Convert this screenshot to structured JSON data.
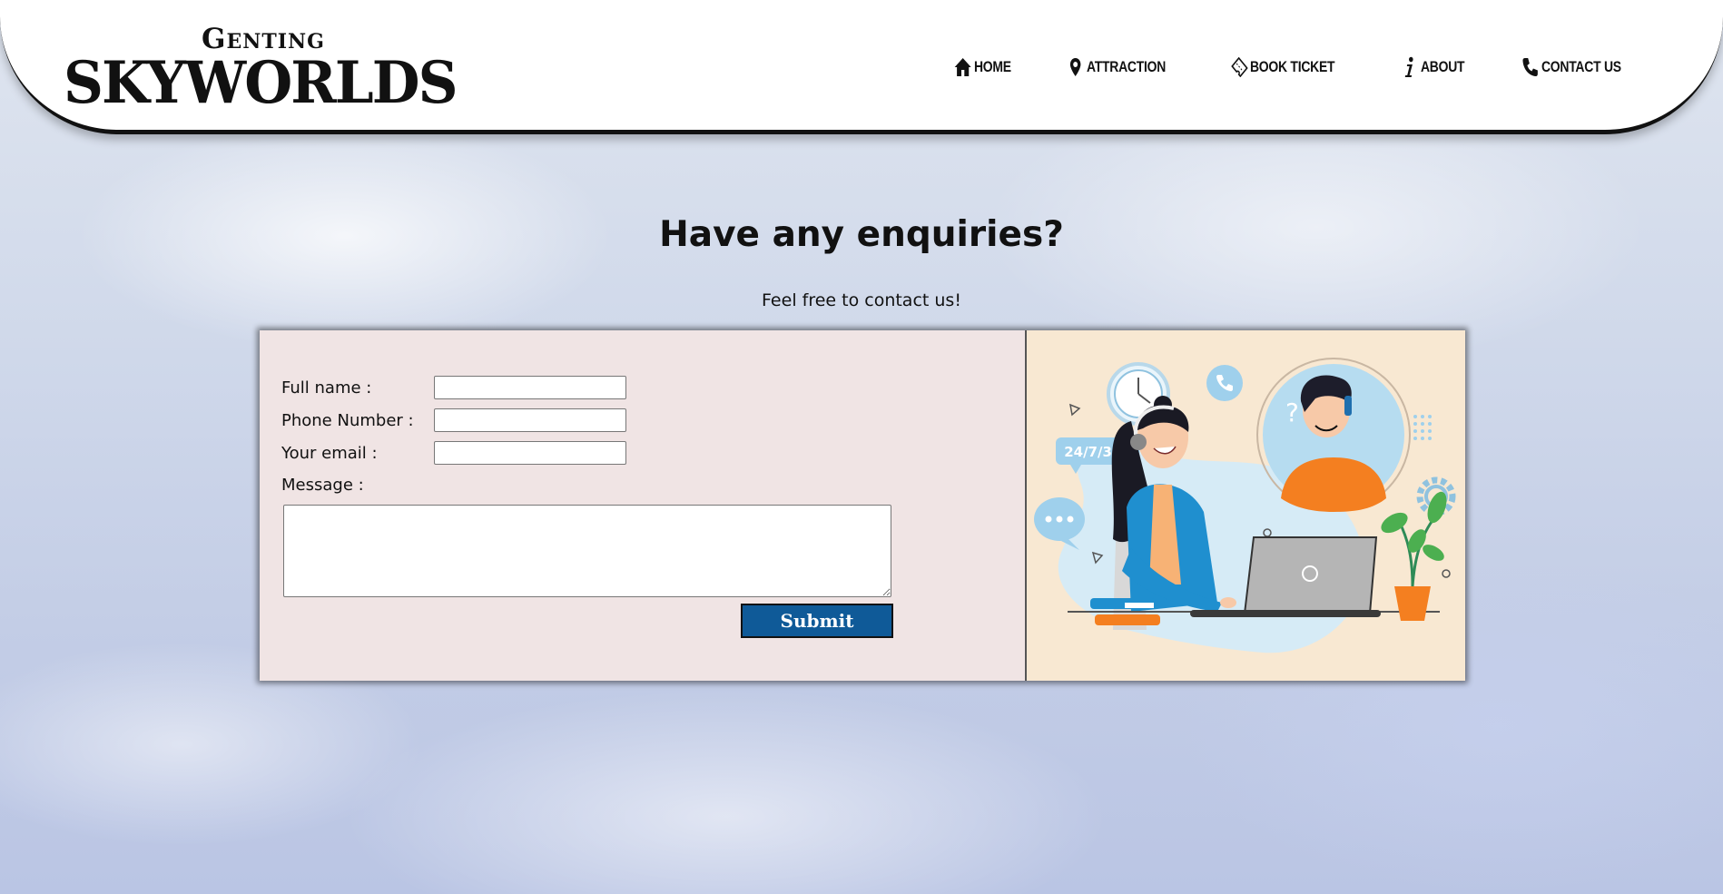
{
  "logo": {
    "top_text": "Genting",
    "main_text": "SKYWORLDS"
  },
  "nav": {
    "items": [
      {
        "label": "HOME",
        "icon": "home-icon"
      },
      {
        "label": "ATTRACTION",
        "icon": "map-pin-icon"
      },
      {
        "label": "BOOK TICKET",
        "icon": "ticket-icon"
      },
      {
        "label": "ABOUT",
        "icon": "info-icon"
      },
      {
        "label": "CONTACT US",
        "icon": "phone-icon"
      }
    ]
  },
  "main": {
    "title": "Have any enquiries?",
    "subtitle": "Feel free to contact us!"
  },
  "form": {
    "full_name_label": "Full name :",
    "full_name_value": "",
    "phone_label": "Phone Number :",
    "phone_value": "",
    "email_label": "Your email :",
    "email_value": "",
    "message_label": "Message :",
    "message_value": "",
    "submit_label": "Submit"
  },
  "illustration": {
    "badge_text": "24/7/365",
    "description_icon": "customer-support-illustration"
  },
  "colors": {
    "submit_bg": "#0f5a98",
    "form_bg": "#f0e4e4",
    "image_bg": "#f8e8d2"
  }
}
